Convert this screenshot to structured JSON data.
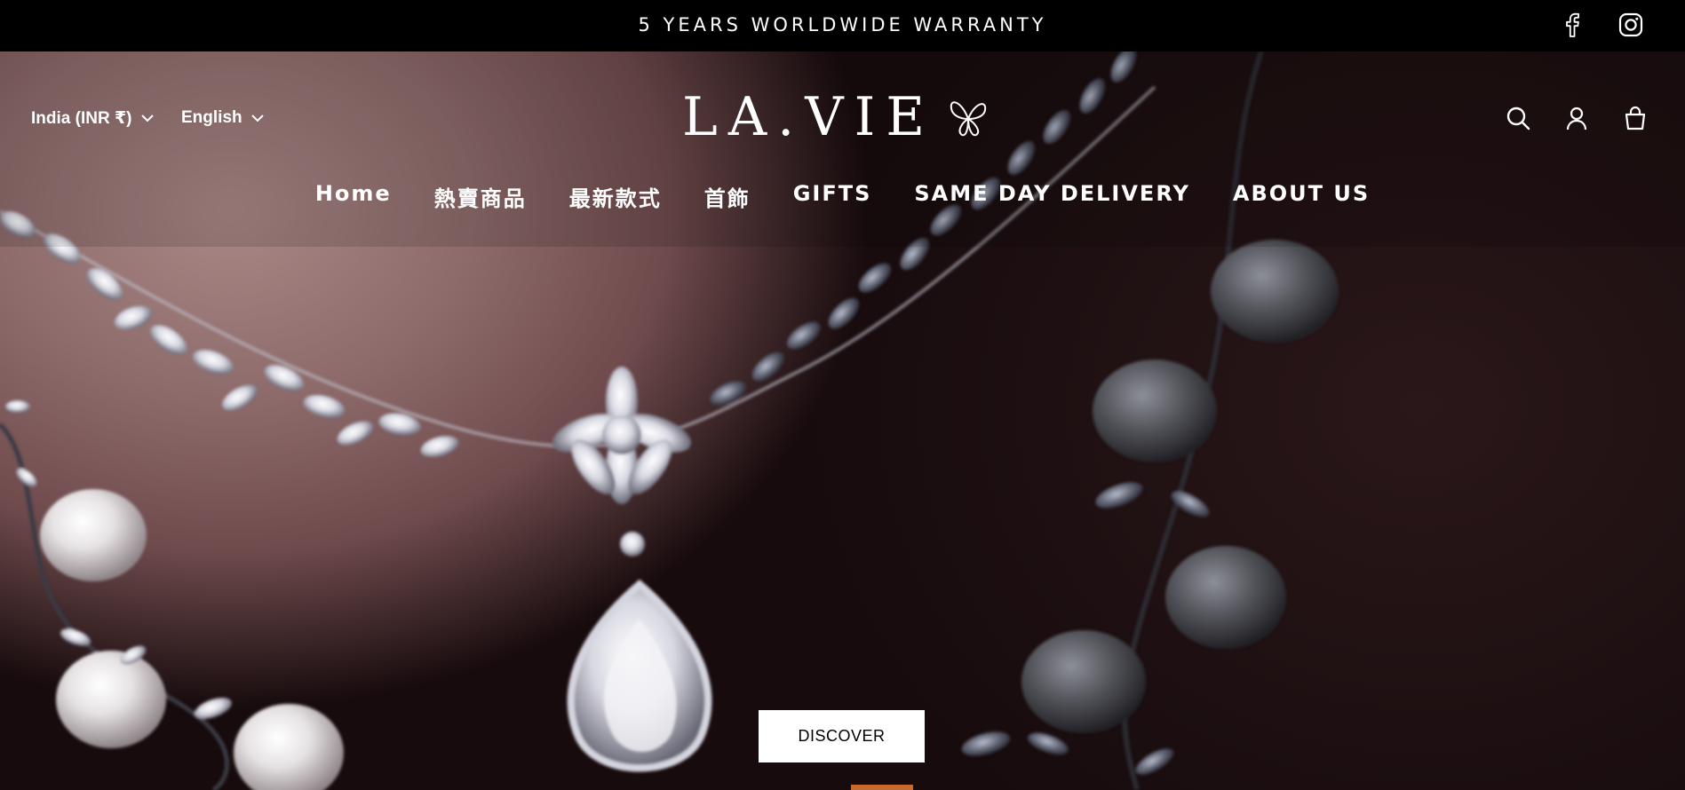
{
  "announcement": {
    "text": "5 YEARS WORLDWIDE WARRANTY"
  },
  "social": {
    "facebook_icon": "facebook-icon",
    "instagram_icon": "instagram-icon"
  },
  "header": {
    "country_selector": "India (INR ₹)",
    "language_selector": "English",
    "logo_text": "LA.VIE",
    "icons": [
      "search-icon",
      "account-icon",
      "cart-icon"
    ]
  },
  "nav": {
    "items": [
      {
        "label": "Home"
      },
      {
        "label": "熱賣商品"
      },
      {
        "label": "最新款式"
      },
      {
        "label": "首飾"
      },
      {
        "label": "GIFTS"
      },
      {
        "label": "SAME DAY DELIVERY"
      },
      {
        "label": "ABOUT US"
      }
    ]
  },
  "hero": {
    "cta_label": "DISCOVER"
  },
  "colors": {
    "announcement_bg": "#000000",
    "text_light": "#ffffff",
    "cta_bg": "#ffffff",
    "cta_text": "#000000"
  }
}
